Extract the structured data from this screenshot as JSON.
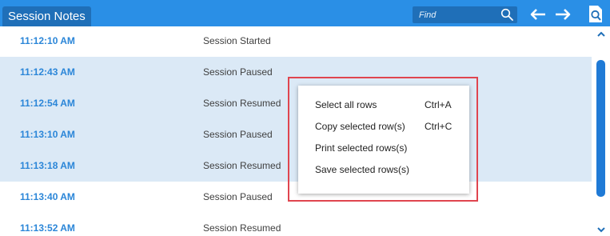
{
  "header": {
    "title": "Session Notes"
  },
  "search": {
    "placeholder": "Find"
  },
  "icons": {
    "search": "search-icon",
    "back": "arrow-left-icon",
    "forward": "arrow-right-icon",
    "zoom": "zoom-page-icon",
    "scroll_up": "chevron-up-icon",
    "scroll_down": "chevron-down-icon"
  },
  "rows": [
    {
      "time": "11:12:10 AM",
      "event": "Session Started",
      "selected": false
    },
    {
      "time": "11:12:43 AM",
      "event": "Session Paused",
      "selected": true
    },
    {
      "time": "11:12:54 AM",
      "event": "Session Resumed",
      "selected": true
    },
    {
      "time": "11:13:10 AM",
      "event": "Session Paused",
      "selected": true
    },
    {
      "time": "11:13:18 AM",
      "event": "Session Resumed",
      "selected": true
    },
    {
      "time": "11:13:40 AM",
      "event": "Session Paused",
      "selected": false
    },
    {
      "time": "11:13:52 AM",
      "event": "Session Resumed",
      "selected": false
    }
  ],
  "context_menu": {
    "items": [
      {
        "label": "Select all rows",
        "shortcut": "Ctrl+A"
      },
      {
        "label": "Copy selected row(s)",
        "shortcut": "Ctrl+C"
      },
      {
        "label": "Print selected rows(s)",
        "shortcut": ""
      },
      {
        "label": "Save selected rows(s)",
        "shortcut": ""
      }
    ]
  },
  "colors": {
    "header": "#2a8fe6",
    "tab": "#1f6fb8",
    "selection": "#dbe9f6",
    "time_text": "#2b86d8",
    "scrollbar": "#1f7ad6",
    "highlight_outline": "#e0454f"
  }
}
